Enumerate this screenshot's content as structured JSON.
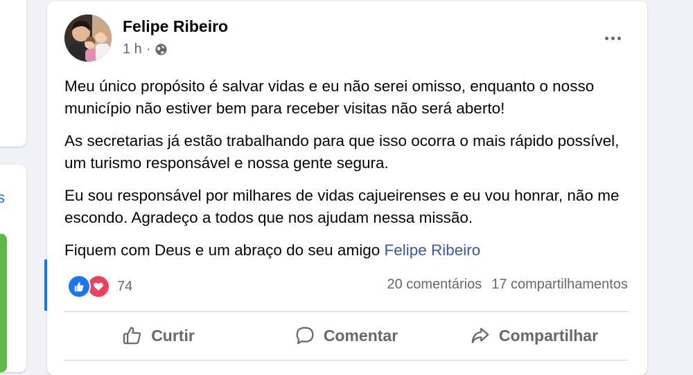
{
  "post": {
    "author": "Felipe Ribeiro",
    "time": "1 h",
    "privacy_icon": "globe-icon",
    "paragraphs": [
      "Meu único propósito é salvar vidas e eu não serei omisso, enquanto o nosso município não estiver bem para receber visitas não será aberto!",
      "As secretarias já estão trabalhando para que isso ocorra o mais rápido possível, um turismo responsável e nossa gente segura.",
      "Eu sou responsável por milhares de vidas cajueirenses e eu vou honrar, não me escondo. Agradeço a todos que nos ajudam nessa missão."
    ],
    "closing_text": "Fiquem com Deus e um abraço do seu amigo ",
    "closing_mention": "Felipe Ribeiro",
    "reaction_count": "74",
    "comments": "20 comentários",
    "shares": "17 compartilhamentos",
    "actions": {
      "like": "Curtir",
      "comment": "Comentar",
      "share": "Compartilhar"
    }
  },
  "sidebar": {
    "partial_letter": "s"
  },
  "colors": {
    "link": "#385898",
    "like": "#1877f2",
    "love": "#f33e58",
    "secondary_text": "#65676b"
  }
}
